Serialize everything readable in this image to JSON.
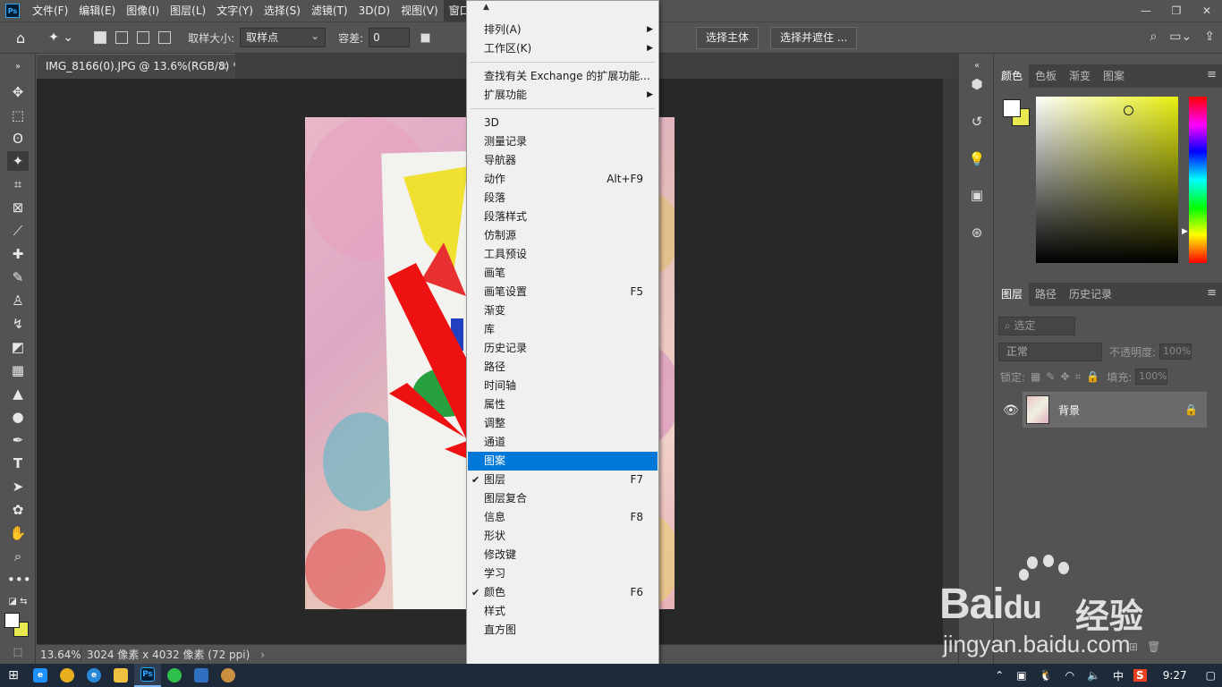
{
  "menubar": {
    "logo": "Ps",
    "items": [
      "文件(F)",
      "编辑(E)",
      "图像(I)",
      "图层(L)",
      "文字(Y)",
      "选择(S)",
      "滤镜(T)",
      "3D(D)",
      "视图(V)",
      "窗口(W)"
    ],
    "window_controls": [
      "—",
      "❐",
      "✕"
    ]
  },
  "optionsbar": {
    "sample_size_label": "取样大小:",
    "sample_size_value": "取样点",
    "tolerance_label": "容差:",
    "tolerance_value": "0",
    "select_subject": "选择主体",
    "select_and_mask": "选择并遮住 ..."
  },
  "document": {
    "tab_title": "IMG_8166(0).JPG @ 13.6%(RGB/8) *",
    "close": "×",
    "zoom": "13.64%",
    "info": "3024 像素 x 4032 像素 (72 ppi)"
  },
  "color_panel": {
    "tabs": [
      "颜色",
      "色板",
      "渐变",
      "图案"
    ],
    "foreground": "#ffffff",
    "background": "#e8e850"
  },
  "layers_panel": {
    "tabs": [
      "图层",
      "路径",
      "历史记录"
    ],
    "filter_label": "选定",
    "blend_mode": "正常",
    "opacity_label": "不透明度:",
    "opacity_value": "100%",
    "lock_label": "锁定:",
    "fill_label": "填充:",
    "fill_value": "100%",
    "layer_name": "背景"
  },
  "window_menu": {
    "items": [
      {
        "label": "排列(A)",
        "submenu": true
      },
      {
        "label": "工作区(K)",
        "submenu": true
      },
      {
        "label": "查找有关 Exchange 的扩展功能..."
      },
      {
        "label": "扩展功能",
        "submenu": true
      },
      {
        "label": "3D"
      },
      {
        "label": "测量记录"
      },
      {
        "label": "导航器"
      },
      {
        "label": "动作",
        "shortcut": "Alt+F9"
      },
      {
        "label": "段落"
      },
      {
        "label": "段落样式"
      },
      {
        "label": "仿制源"
      },
      {
        "label": "工具预设"
      },
      {
        "label": "画笔"
      },
      {
        "label": "画笔设置",
        "shortcut": "F5"
      },
      {
        "label": "渐变"
      },
      {
        "label": "库"
      },
      {
        "label": "历史记录"
      },
      {
        "label": "路径"
      },
      {
        "label": "时间轴"
      },
      {
        "label": "属性"
      },
      {
        "label": "调整"
      },
      {
        "label": "通道"
      },
      {
        "label": "图案",
        "highlighted": true
      },
      {
        "label": "图层",
        "shortcut": "F7",
        "checked": true
      },
      {
        "label": "图层复合"
      },
      {
        "label": "信息",
        "shortcut": "F8"
      },
      {
        "label": "形状"
      },
      {
        "label": "修改键"
      },
      {
        "label": "学习"
      },
      {
        "label": "颜色",
        "shortcut": "F6",
        "checked": true
      },
      {
        "label": "样式"
      },
      {
        "label": "直方图"
      }
    ]
  },
  "watermark": {
    "brand": "Bai",
    "brand_suffix": "du",
    "cn": "经验",
    "url": "jingyan.baidu.com"
  },
  "taskbar": {
    "tray_ime": "中",
    "tray_sogou": "S",
    "clock": "9:27",
    "ps_label": "Ps"
  }
}
